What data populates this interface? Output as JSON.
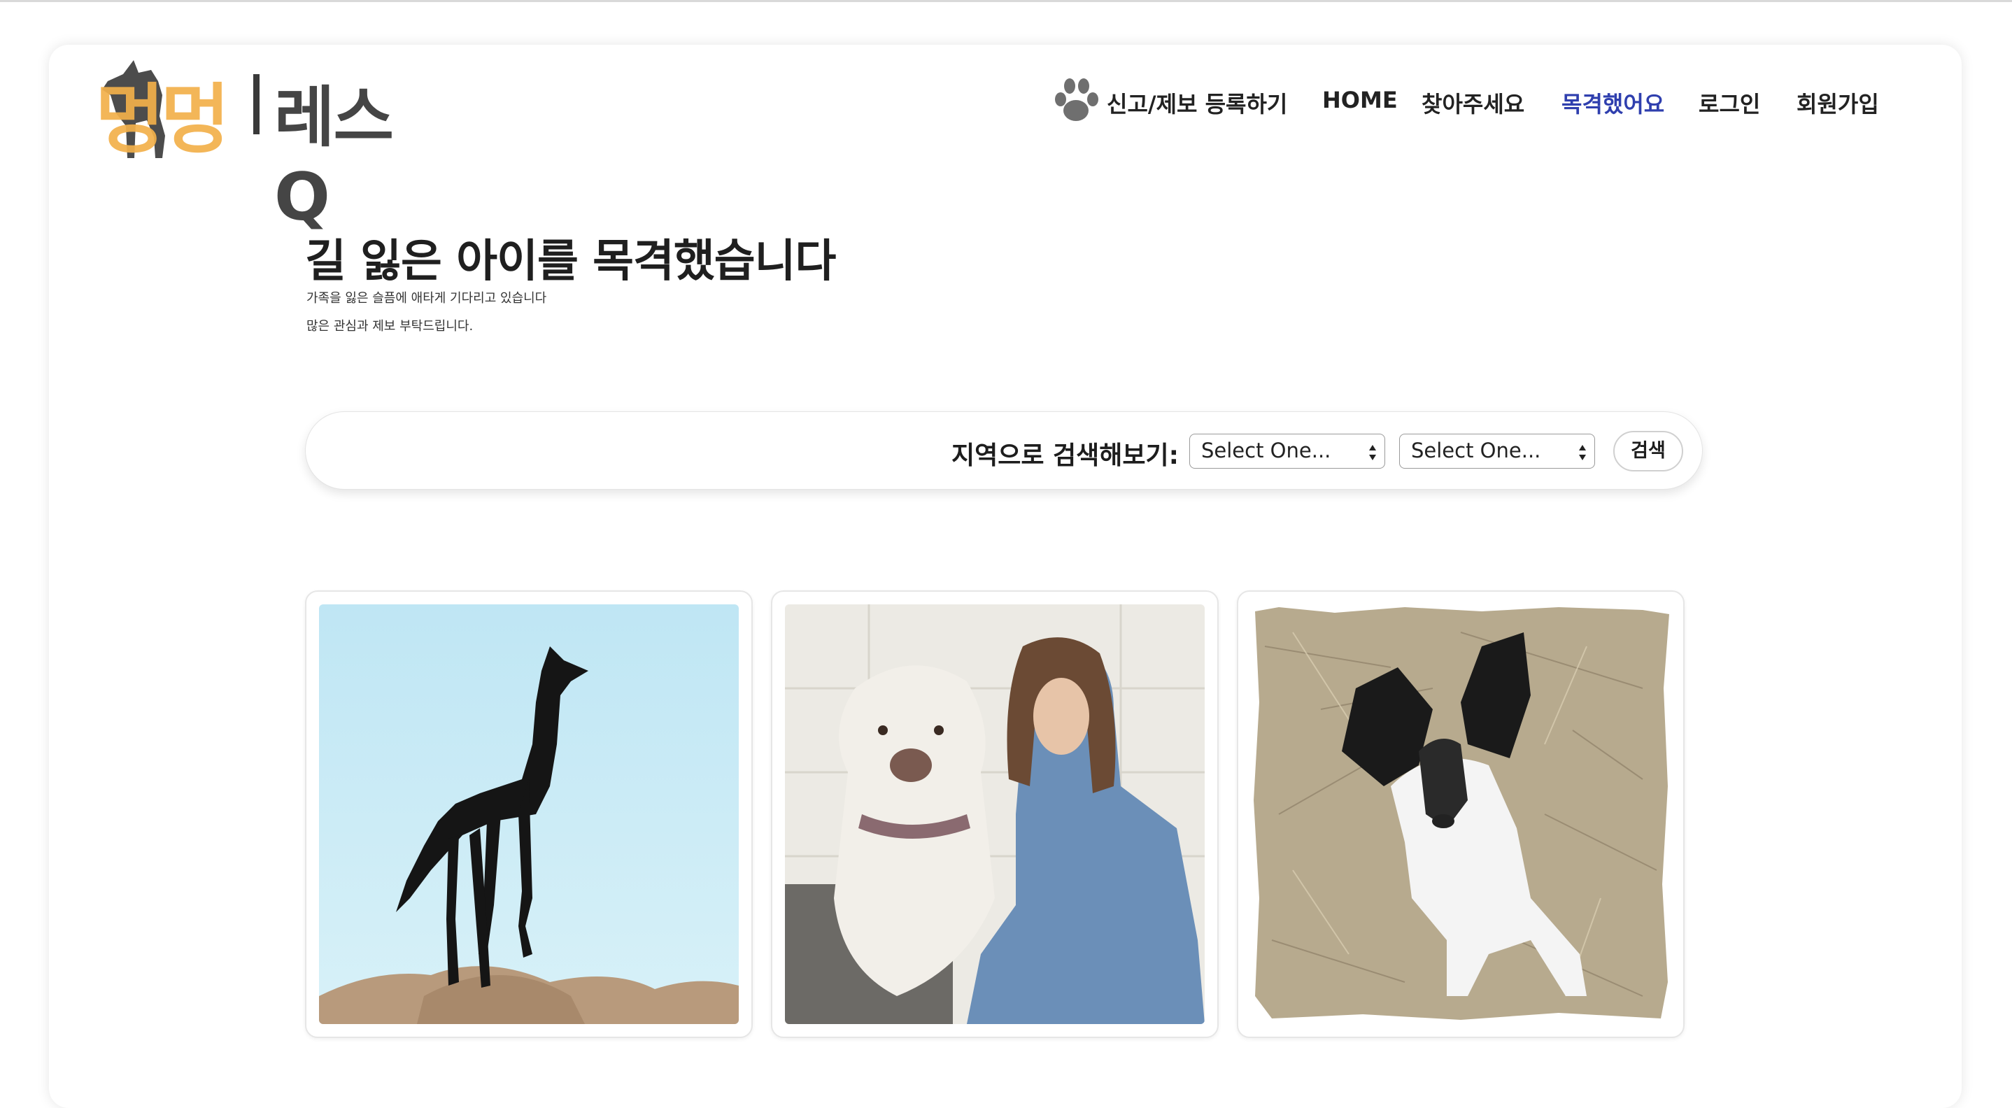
{
  "header": {
    "logo_text": "멍멍",
    "site_name": "레스Q",
    "nav": [
      {
        "label": "신고/제보 등록하기",
        "icon": "paw-icon"
      },
      {
        "label": "HOME"
      },
      {
        "label": "찾아주세요"
      },
      {
        "label": "목격했어요",
        "active": true
      },
      {
        "label": "로그인"
      },
      {
        "label": "회원가입"
      }
    ],
    "active_color": "#2f3fae"
  },
  "hero": {
    "title": "길 잃은 아이를 목격했습니다",
    "subtitle_lines": [
      "가족을 잃은 슬픔에 애타게 기다리고 있습니다",
      "많은 관심과 제보 부탁드립니다."
    ]
  },
  "search": {
    "label": "지역으로 검색해보기:",
    "select_1": "Select One...",
    "select_2": "Select One...",
    "button": "검색"
  },
  "cards": [
    {
      "photo": "black-dog-on-rock"
    },
    {
      "photo": "white-dog-with-woman"
    },
    {
      "photo": "puppy-on-straw"
    }
  ]
}
